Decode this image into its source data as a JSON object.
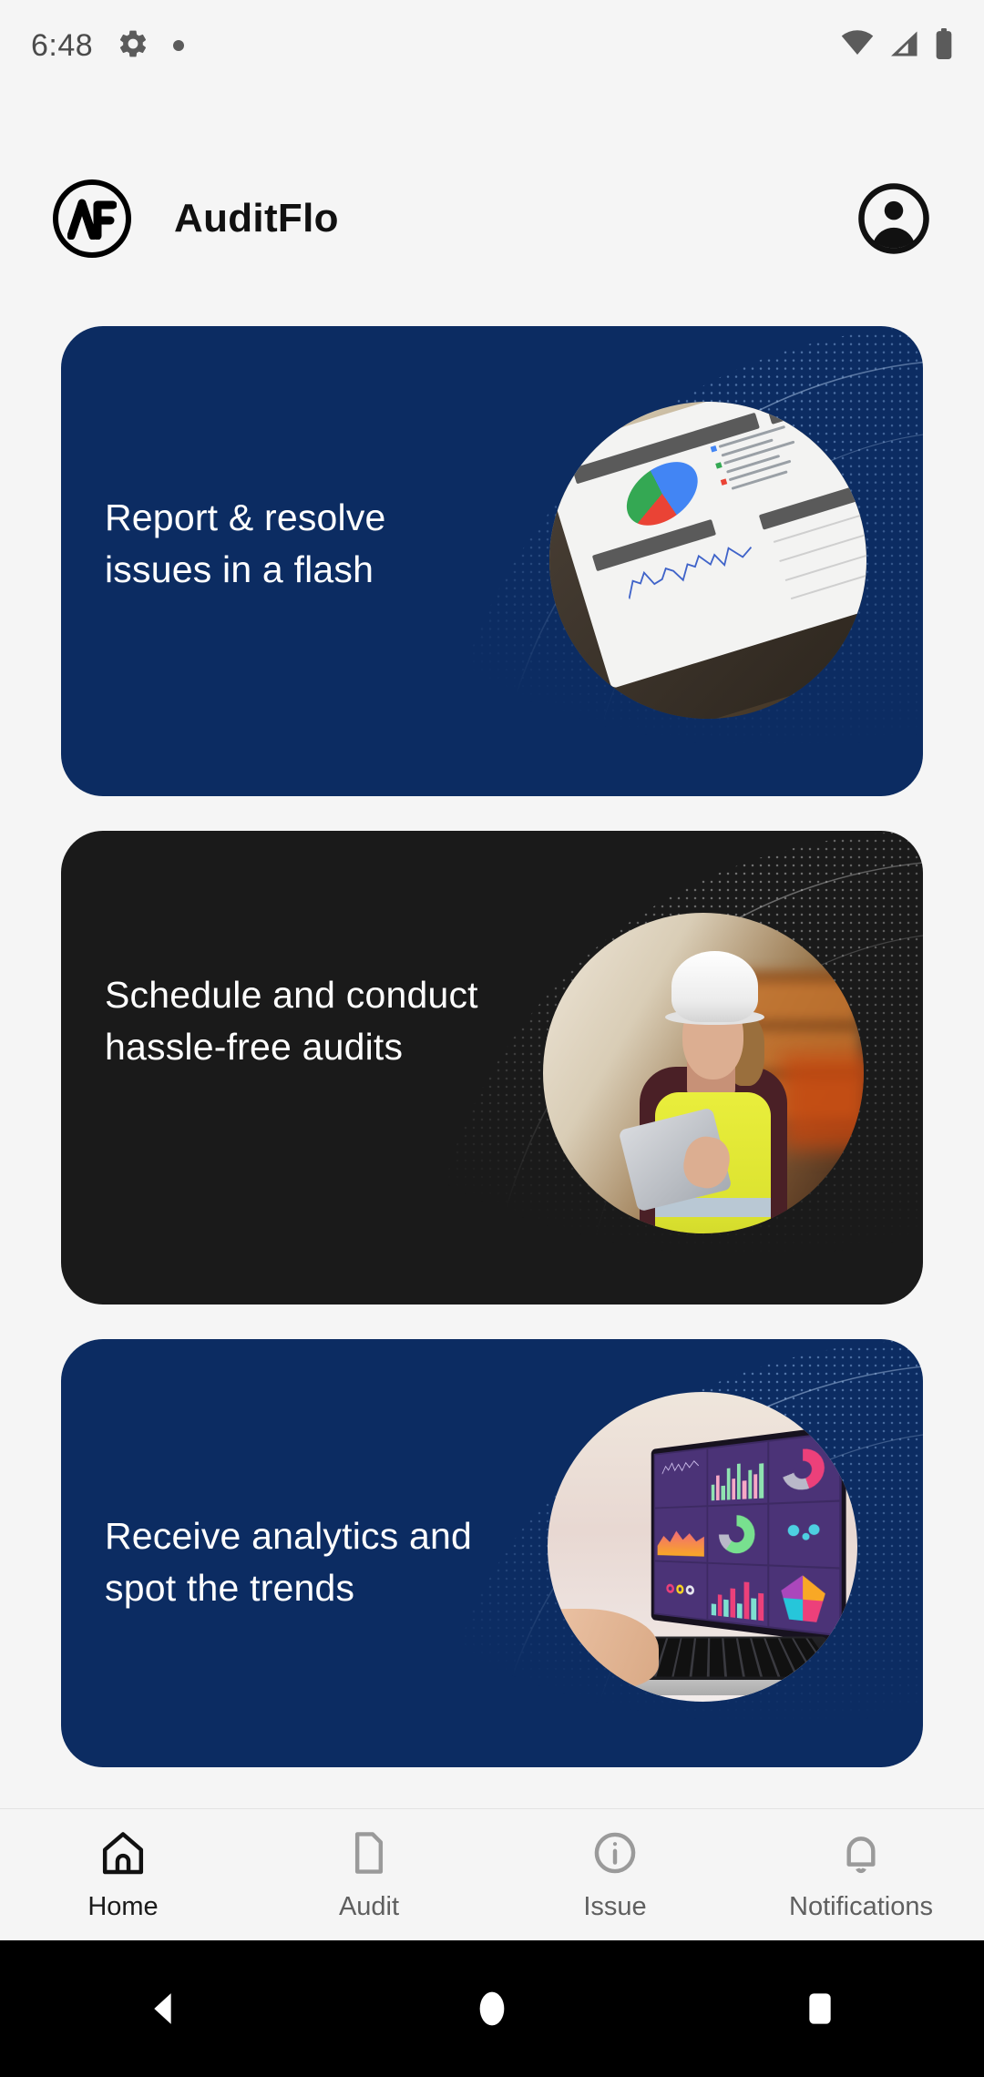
{
  "status_bar": {
    "time": "6:48",
    "left_icons": [
      "settings-gear-icon",
      "notification-dot"
    ],
    "right_icons": [
      "wifi-icon",
      "cell-signal-icon",
      "battery-icon"
    ]
  },
  "header": {
    "logo_text": "AF",
    "brand": "AuditFlo",
    "account_icon": "account-circle-icon"
  },
  "cards": [
    {
      "title": "Report & resolve issues in a flash",
      "bg_color": "#0c2c62",
      "theme": "navy",
      "image_alt": "tablet-analytics-dashboard"
    },
    {
      "title": "Schedule and conduct hassle-free audits",
      "bg_color": "#1a1a1a",
      "theme": "dark",
      "image_alt": "inspector-with-tablet-in-warehouse"
    },
    {
      "title": "Receive analytics and spot the trends",
      "bg_color": "#0c2c62",
      "theme": "navy",
      "image_alt": "laptop-analytics-dashboard"
    }
  ],
  "bottom_nav": {
    "active_index": 0,
    "items": [
      {
        "label": "Home",
        "icon": "home-icon"
      },
      {
        "label": "Audit",
        "icon": "document-icon"
      },
      {
        "label": "Issue",
        "icon": "info-circle-icon"
      },
      {
        "label": "Notifications",
        "icon": "bell-icon"
      }
    ]
  },
  "system_nav": {
    "buttons": [
      {
        "name": "back",
        "icon": "back-triangle-icon"
      },
      {
        "name": "home",
        "icon": "home-circle-icon"
      },
      {
        "name": "recents",
        "icon": "recents-square-icon"
      }
    ]
  }
}
